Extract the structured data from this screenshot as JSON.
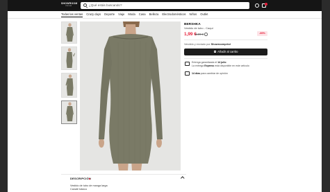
{
  "header": {
    "logo_main": "SHOWROOM",
    "logo_sub": "PRIVÉ",
    "search_placeholder": "¿Qué estás buscando?"
  },
  "categories": [
    {
      "label": "Todas las ventas",
      "active": true
    },
    {
      "label": "Crazy days",
      "active": false
    },
    {
      "label": "Deporte",
      "active": false
    },
    {
      "label": "Viaje",
      "active": false
    },
    {
      "label": "Moda",
      "active": false
    },
    {
      "label": "Casa",
      "active": false
    },
    {
      "label": "Belleza",
      "active": false
    },
    {
      "label": "Electrodomésticos",
      "active": false
    },
    {
      "label": "Niños",
      "active": false
    },
    {
      "label": "Outlet",
      "active": false
    }
  ],
  "product": {
    "brand": "BERSHKA",
    "name": "Vestido de tubo - Caqui",
    "price": "1,99 €",
    "old_price": "9,99 €",
    "discount": "-80%",
    "seller_prefix": "Vendido y enviado por ",
    "seller_name": "Showroomprivé",
    "add_to_cart": "Añadir al carrito",
    "delivery_line1_prefix": "Entrega garantizada el ",
    "delivery_date": "14 julio",
    "delivery_line2_prefix": "La entrega ",
    "delivery_express": "Express",
    "delivery_line2_suffix": " está disponible en este artículo",
    "returns_bold": "14 días",
    "returns_rest": " para cambiar de opinión",
    "dress_color": "#7a7a66"
  },
  "description": {
    "title": "DESCRIPCIÓN",
    "line1": "Vestido de tubo de manga larga",
    "line2": "Canalé básico"
  },
  "colors": {
    "accent_red": "#e6203a",
    "header_bg": "#151515"
  }
}
